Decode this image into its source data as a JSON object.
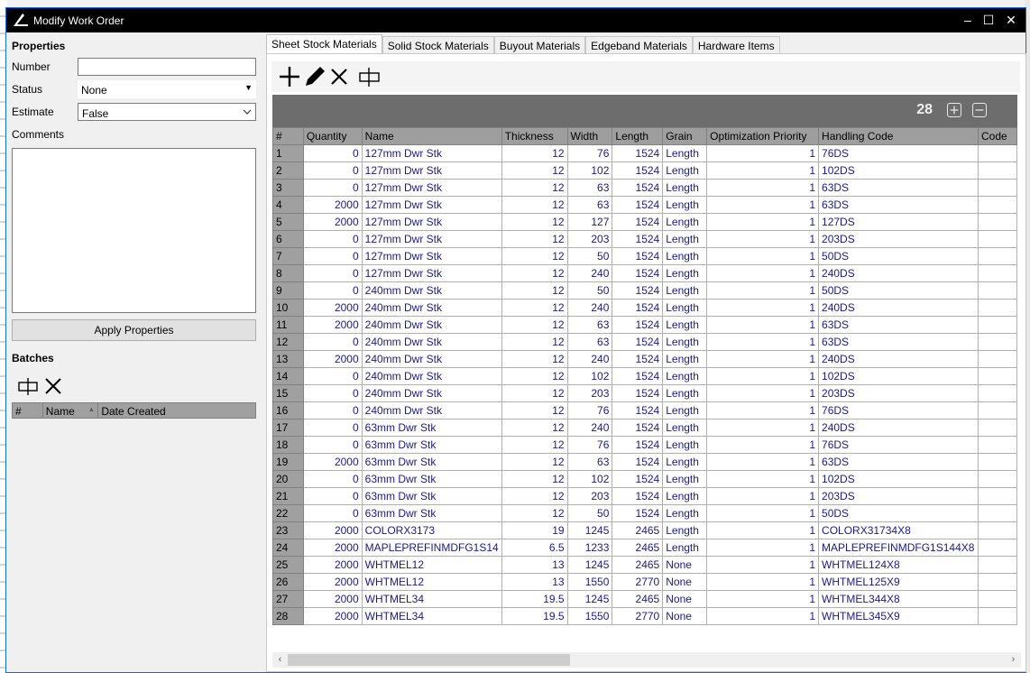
{
  "window": {
    "title": "Modify Work Order",
    "minimize": "–",
    "maximize": "☐",
    "close": "✕"
  },
  "properties": {
    "heading": "Properties",
    "number_label": "Number",
    "number_value": "",
    "status_label": "Status",
    "status_value": "None",
    "estimate_label": "Estimate",
    "estimate_value": "False",
    "comments_label": "Comments",
    "comments_value": "",
    "apply_label": "Apply Properties"
  },
  "batches": {
    "heading": "Batches",
    "columns": [
      "#",
      "Name",
      "Date Created"
    ]
  },
  "tabs": [
    "Sheet Stock Materials",
    "Solid Stock Materials",
    "Buyout Materials",
    "Edgeband Materials",
    "Hardware Items"
  ],
  "grid": {
    "count": "28",
    "columns": [
      "#",
      "Quantity",
      "Name",
      "Thickness",
      "Width",
      "Length",
      "Grain",
      "Optimization Priority",
      "Handling Code",
      "Code"
    ],
    "rows": [
      [
        "1",
        "0",
        "127mm Dwr Stk",
        "12",
        "76",
        "1524",
        "Length",
        "1",
        "76DS",
        ""
      ],
      [
        "2",
        "0",
        "127mm Dwr Stk",
        "12",
        "102",
        "1524",
        "Length",
        "1",
        "102DS",
        ""
      ],
      [
        "3",
        "0",
        "127mm Dwr Stk",
        "12",
        "63",
        "1524",
        "Length",
        "1",
        "63DS",
        ""
      ],
      [
        "4",
        "2000",
        "127mm Dwr Stk",
        "12",
        "63",
        "1524",
        "Length",
        "1",
        "63DS",
        ""
      ],
      [
        "5",
        "2000",
        "127mm Dwr Stk",
        "12",
        "127",
        "1524",
        "Length",
        "1",
        "127DS",
        ""
      ],
      [
        "6",
        "0",
        "127mm Dwr Stk",
        "12",
        "203",
        "1524",
        "Length",
        "1",
        "203DS",
        ""
      ],
      [
        "7",
        "0",
        "127mm Dwr Stk",
        "12",
        "50",
        "1524",
        "Length",
        "1",
        "50DS",
        ""
      ],
      [
        "8",
        "0",
        "127mm Dwr Stk",
        "12",
        "240",
        "1524",
        "Length",
        "1",
        "240DS",
        ""
      ],
      [
        "9",
        "0",
        "240mm Dwr Stk",
        "12",
        "50",
        "1524",
        "Length",
        "1",
        "50DS",
        ""
      ],
      [
        "10",
        "2000",
        "240mm Dwr Stk",
        "12",
        "240",
        "1524",
        "Length",
        "1",
        "240DS",
        ""
      ],
      [
        "11",
        "2000",
        "240mm Dwr Stk",
        "12",
        "63",
        "1524",
        "Length",
        "1",
        "63DS",
        ""
      ],
      [
        "12",
        "0",
        "240mm Dwr Stk",
        "12",
        "63",
        "1524",
        "Length",
        "1",
        "63DS",
        ""
      ],
      [
        "13",
        "2000",
        "240mm Dwr Stk",
        "12",
        "240",
        "1524",
        "Length",
        "1",
        "240DS",
        ""
      ],
      [
        "14",
        "0",
        "240mm Dwr Stk",
        "12",
        "102",
        "1524",
        "Length",
        "1",
        "102DS",
        ""
      ],
      [
        "15",
        "0",
        "240mm Dwr Stk",
        "12",
        "203",
        "1524",
        "Length",
        "1",
        "203DS",
        ""
      ],
      [
        "16",
        "0",
        "240mm Dwr Stk",
        "12",
        "76",
        "1524",
        "Length",
        "1",
        "76DS",
        ""
      ],
      [
        "17",
        "0",
        "63mm Dwr Stk",
        "12",
        "240",
        "1524",
        "Length",
        "1",
        "240DS",
        ""
      ],
      [
        "18",
        "0",
        "63mm Dwr Stk",
        "12",
        "76",
        "1524",
        "Length",
        "1",
        "76DS",
        ""
      ],
      [
        "19",
        "2000",
        "63mm Dwr Stk",
        "12",
        "63",
        "1524",
        "Length",
        "1",
        "63DS",
        ""
      ],
      [
        "20",
        "0",
        "63mm Dwr Stk",
        "12",
        "102",
        "1524",
        "Length",
        "1",
        "102DS",
        ""
      ],
      [
        "21",
        "0",
        "63mm Dwr Stk",
        "12",
        "203",
        "1524",
        "Length",
        "1",
        "203DS",
        ""
      ],
      [
        "22",
        "0",
        "63mm Dwr Stk",
        "12",
        "50",
        "1524",
        "Length",
        "1",
        "50DS",
        ""
      ],
      [
        "23",
        "2000",
        "COLORX3173",
        "19",
        "1245",
        "2465",
        "Length",
        "1",
        "COLORX31734X8",
        ""
      ],
      [
        "24",
        "2000",
        "MAPLEPREFINMDFG1S14",
        "6.5",
        "1233",
        "2465",
        "Length",
        "1",
        "MAPLEPREFINMDFG1S144X8",
        ""
      ],
      [
        "25",
        "2000",
        "WHTMEL12",
        "13",
        "1245",
        "2465",
        "None",
        "1",
        "WHTMEL124X8",
        ""
      ],
      [
        "26",
        "2000",
        "WHTMEL12",
        "13",
        "1550",
        "2770",
        "None",
        "1",
        "WHTMEL125X9",
        ""
      ],
      [
        "27",
        "2000",
        "WHTMEL34",
        "19.5",
        "1245",
        "2465",
        "None",
        "1",
        "WHTMEL344X8",
        ""
      ],
      [
        "28",
        "2000",
        "WHTMEL34",
        "19.5",
        "1550",
        "2770",
        "None",
        "1",
        "WHTMEL345X9",
        ""
      ]
    ]
  },
  "scroll": {
    "left": "‹",
    "right": "›"
  },
  "icons": {
    "toolbar": [
      "add-icon",
      "edit-icon",
      "delete-icon",
      "split-icon"
    ],
    "batch_toolbar": [
      "split-icon",
      "delete-icon"
    ]
  }
}
